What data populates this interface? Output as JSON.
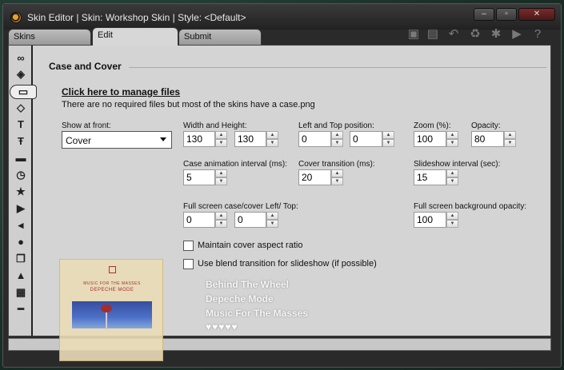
{
  "window": {
    "title": "Skin Editor | Skin: Workshop Skin | Style: <Default>",
    "controls": {
      "minimize": "–",
      "maximize": "▫",
      "close": "✕"
    }
  },
  "tabs": [
    {
      "label": "Skins",
      "active": false
    },
    {
      "label": "Edit",
      "active": true
    },
    {
      "label": "Submit",
      "active": false
    }
  ],
  "toolbar_icons": [
    "save-icon",
    "save-all-icon",
    "undo-icon",
    "recycle-icon",
    "asterisk-icon",
    "play-icon",
    "help-icon"
  ],
  "sidebar_icons": [
    "mask-icon",
    "dot-icon",
    "rectangle-icon",
    "diamond-icon",
    "text-icon",
    "text-format-icon",
    "line-icon",
    "clock-icon",
    "star-icon",
    "play-icon",
    "volume-icon",
    "speech-bubble-icon",
    "copy-icon",
    "layers-icon",
    "grid-icon",
    "divider-icon"
  ],
  "section": {
    "title": "Case and Cover",
    "manage_link": "Click here to manage files",
    "info": "There are no required files but most of the skins have a case.png"
  },
  "fields": {
    "show_at_front": {
      "label": "Show at front:",
      "value": "Cover"
    },
    "width_height": {
      "label": "Width and Height:",
      "width": "130",
      "height": "130"
    },
    "left_top": {
      "label": "Left and Top position:",
      "left": "0",
      "top": "0"
    },
    "zoom": {
      "label": "Zoom (%):",
      "value": "100"
    },
    "opacity": {
      "label": "Opacity:",
      "value": "80"
    },
    "case_anim": {
      "label": "Case animation interval (ms):",
      "value": "5"
    },
    "cover_transition": {
      "label": "Cover transition (ms):",
      "value": "20"
    },
    "slideshow_interval": {
      "label": "Slideshow interval (sec):",
      "value": "15"
    },
    "fullscreen_left_top": {
      "label": "Full screen case/cover Left/ Top:",
      "left": "0",
      "top": "0"
    },
    "fullscreen_bg_opacity": {
      "label": "Full screen background opacity:",
      "value": "100"
    }
  },
  "checkboxes": {
    "aspect": {
      "label": "Maintain cover aspect ratio",
      "checked": false
    },
    "blend": {
      "label": "Use blend transition for slideshow (if possible)",
      "checked": false
    }
  },
  "preview": {
    "cover": {
      "line1": "MUSIC FOR THE MASSES",
      "line2": "DEPECHE MODE"
    },
    "track_title": "Behind The Wheel",
    "artist": "Depeche Mode",
    "album": "Music For The Masses",
    "rating_text": "♥♥♥♥♥"
  }
}
